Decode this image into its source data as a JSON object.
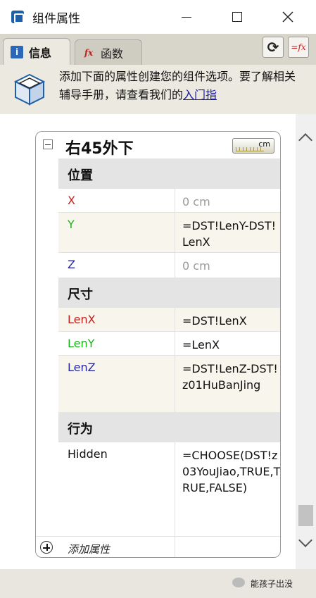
{
  "window": {
    "title": "组件属性"
  },
  "tabs": [
    {
      "label": "信息",
      "icon": "info-icon",
      "active": true
    },
    {
      "label": "函数",
      "icon": "fx-icon",
      "active": false
    }
  ],
  "toolbar": {
    "refresh_icon": "refresh-icon",
    "fx_icon": "formula-fx-icon"
  },
  "banner": {
    "text": "添加下面的属性创建您的组件选项。要了解相关辅导手册，请查看我们的",
    "link": "入门指"
  },
  "component": {
    "name": "右45外下",
    "unit": "cm"
  },
  "sections": [
    {
      "title": "位置",
      "rows": [
        {
          "name": "X",
          "value": "0 cm"
        },
        {
          "name": "Y",
          "value": "=DST!LenY-DST!LenX"
        },
        {
          "name": "Z",
          "value": "0 cm"
        }
      ]
    },
    {
      "title": "尺寸",
      "rows": [
        {
          "name": "LenX",
          "value": "=DST!LenX"
        },
        {
          "name": "LenY",
          "value": "=LenX"
        },
        {
          "name": "LenZ",
          "value": "=DST!LenZ-DST!z01HuBanJing"
        }
      ]
    },
    {
      "title": "行为",
      "rows": [
        {
          "name": "Hidden",
          "value": "=CHOOSE(DST!z03YouJiao,TRUE,TRUE,FALSE)"
        }
      ]
    }
  ],
  "add_attribute": {
    "label": "添加属性"
  },
  "watermark": {
    "text": "能孩子出没"
  },
  "colors": {
    "x_axis": "#c0201e",
    "y_axis": "#1bb31b",
    "z_axis": "#27279e"
  }
}
